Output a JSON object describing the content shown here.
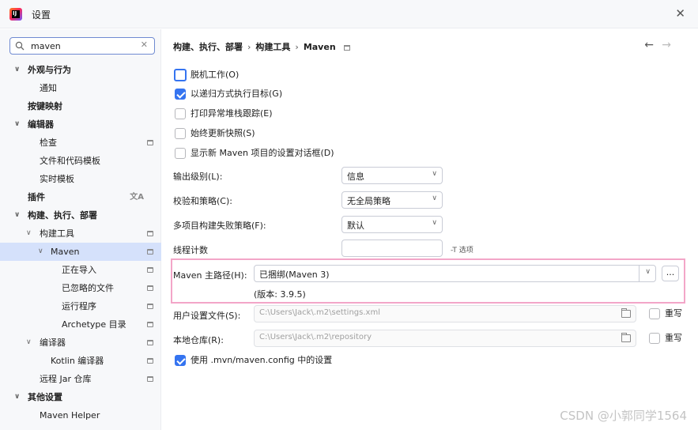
{
  "window": {
    "title": "设置"
  },
  "search": {
    "value": "maven"
  },
  "sidebar": {
    "items": [
      {
        "label": "外观与行为"
      },
      {
        "label": "通知"
      },
      {
        "label": "按键映射"
      },
      {
        "label": "编辑器"
      },
      {
        "label": "检查"
      },
      {
        "label": "文件和代码模板"
      },
      {
        "label": "实时模板"
      },
      {
        "label": "插件"
      },
      {
        "label": "构建、执行、部署"
      },
      {
        "label": "构建工具"
      },
      {
        "label": "Maven"
      },
      {
        "label": "正在导入"
      },
      {
        "label": "已忽略的文件"
      },
      {
        "label": "运行程序"
      },
      {
        "label": "Archetype 目录"
      },
      {
        "label": "编译器"
      },
      {
        "label": "Kotlin 编译器"
      },
      {
        "label": "远程 Jar 仓库"
      },
      {
        "label": "其他设置"
      },
      {
        "label": "Maven Helper"
      }
    ]
  },
  "breadcrumb": {
    "part1": "构建、执行、部署",
    "part2": "构建工具",
    "part3": "Maven"
  },
  "options": {
    "offline": "脱机工作(O)",
    "recursive": "以递归方式执行目标(G)",
    "print_stack": "打印异常堆栈跟踪(E)",
    "update_snapshots": "始终更新快照(S)",
    "show_dialog": "显示新 Maven 项目的设置对话框(D)"
  },
  "fields": {
    "output_level": {
      "label": "输出级别(L):",
      "value": "信息"
    },
    "checksum": {
      "label": "校验和策略(C):",
      "value": "无全局策略"
    },
    "failure": {
      "label": "多项目构建失败策略(F):",
      "value": "默认"
    },
    "threads": {
      "label": "线程计数",
      "hint": "-T 选项"
    },
    "maven_home": {
      "label": "Maven 主路径(H):",
      "value": "已捆绑(Maven 3)",
      "browse": "...",
      "version": "(版本: 3.9.5)"
    },
    "user_settings": {
      "label": "用户设置文件(S):",
      "value": "C:\\Users\\Jack\\.m2\\settings.xml",
      "override": "重写"
    },
    "local_repo": {
      "label": "本地仓库(R):",
      "value": "C:\\Users\\Jack\\.m2\\repository",
      "override": "重写"
    },
    "use_mvn_config": "使用 .mvn/maven.config 中的设置"
  },
  "watermark": "CSDN @小郭同学1564",
  "colors": {
    "accent": "#3574f0",
    "selection": "#d5e1fb",
    "highlight_border": "#f3a6c8"
  }
}
